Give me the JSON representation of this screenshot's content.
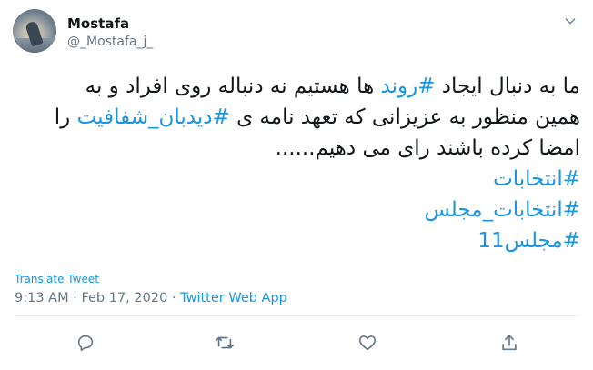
{
  "user": {
    "name": "Mostafa",
    "handle": "@_Mostafa_j_"
  },
  "tweet": {
    "line1": {
      "before": "ما به دنبال ایجاد ",
      "tag": "#روند",
      "after": " ها هستیم نه دنباله روی افراد و به"
    },
    "line2": {
      "before": "همین منظور به عزیزانی که تعهد نامه ی ",
      "tag": "#دیدبان_شفافیت",
      "after": " را"
    },
    "line3": "امضا کرده باشند رای می دهیم......",
    "hashtags": [
      "#انتخابات",
      "#انتخابات_مجلس",
      "#مجلس11"
    ]
  },
  "translate_label": "Translate Tweet",
  "meta": {
    "time": "9:13 AM",
    "separator": " · ",
    "date": "Feb 17, 2020",
    "source": "Twitter Web App"
  },
  "colors": {
    "link": "#1b95e0",
    "text": "#14171a",
    "secondary": "#657786",
    "divider": "#e6ecf0"
  },
  "icons": {
    "caret": "chevron-down-icon",
    "reply": "reply-icon",
    "retweet": "retweet-icon",
    "like": "heart-icon",
    "share": "share-icon"
  }
}
